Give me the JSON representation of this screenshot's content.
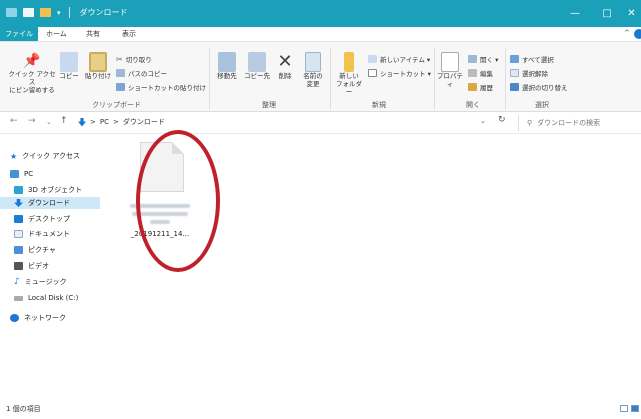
{
  "window": {
    "title": "ダウンロード",
    "controls": {
      "minimize": "—",
      "maximize": "□",
      "close": "✕"
    }
  },
  "ribbon_tabs": [
    "ファイル",
    "ホーム",
    "共有",
    "表示"
  ],
  "ribbon": {
    "clipboard": {
      "label": "クリップボード",
      "pin_quick": "クイック アクセス\nにピン留めする",
      "copy": "コピー",
      "paste": "貼り付け",
      "cut": "切り取り",
      "copy_path": "パスのコピー",
      "paste_shortcut": "ショートカットの貼り付け"
    },
    "organize": {
      "label": "整理",
      "move_to": "移動先",
      "copy_to": "コピー先",
      "delete": "削除",
      "rename": "名前の\n変更"
    },
    "new": {
      "label": "新規",
      "new_folder": "新しい\nフォルダー",
      "new_item": "新しいアイテム ▾",
      "shortcut": "ショートカット ▾"
    },
    "open": {
      "label": "開く",
      "properties": "プロパティ",
      "open": "開く ▾",
      "edit": "編集",
      "history": "履歴"
    },
    "select": {
      "label": "選択",
      "select_all": "すべて選択",
      "select_none": "選択解除",
      "invert": "選択の切り替え"
    }
  },
  "address": {
    "path": [
      "PC",
      "ダウンロード"
    ],
    "separator": ">",
    "search_placeholder": "ダウンロードの検索"
  },
  "sidebar": {
    "items": [
      {
        "label": "クイック アクセス",
        "icon": "star-icon",
        "color": "#1a78d0"
      },
      {
        "label": "PC",
        "icon": "pc-icon",
        "color": "#4a90d9"
      },
      {
        "label": "3D オブジェクト",
        "icon": "cube-icon",
        "color": "#2aa4d8"
      },
      {
        "label": "ダウンロード",
        "icon": "download-icon",
        "color": "#1a78d0",
        "selected": true
      },
      {
        "label": "デスクトップ",
        "icon": "desktop-icon",
        "color": "#1f7bd4"
      },
      {
        "label": "ドキュメント",
        "icon": "document-icon",
        "color": "#8aa9c8"
      },
      {
        "label": "ピクチャ",
        "icon": "picture-icon",
        "color": "#4a90d9"
      },
      {
        "label": "ビデオ",
        "icon": "video-icon",
        "color": "#555555"
      },
      {
        "label": "ミュージック",
        "icon": "music-icon",
        "color": "#1a78d0"
      },
      {
        "label": "Local Disk (C:)",
        "icon": "disk-icon",
        "color": "#888888"
      },
      {
        "label": "ネットワーク",
        "icon": "network-icon",
        "color": "#1a78d0"
      }
    ]
  },
  "files": [
    {
      "name": "_20191211_14...",
      "type": "document-icon",
      "highlighted": true
    }
  ],
  "status": {
    "item_count": "1 個の項目"
  },
  "colors": {
    "accent": "#1aa0b8",
    "selection": "#cfe8f7",
    "highlight_circle": "#c0202a"
  }
}
